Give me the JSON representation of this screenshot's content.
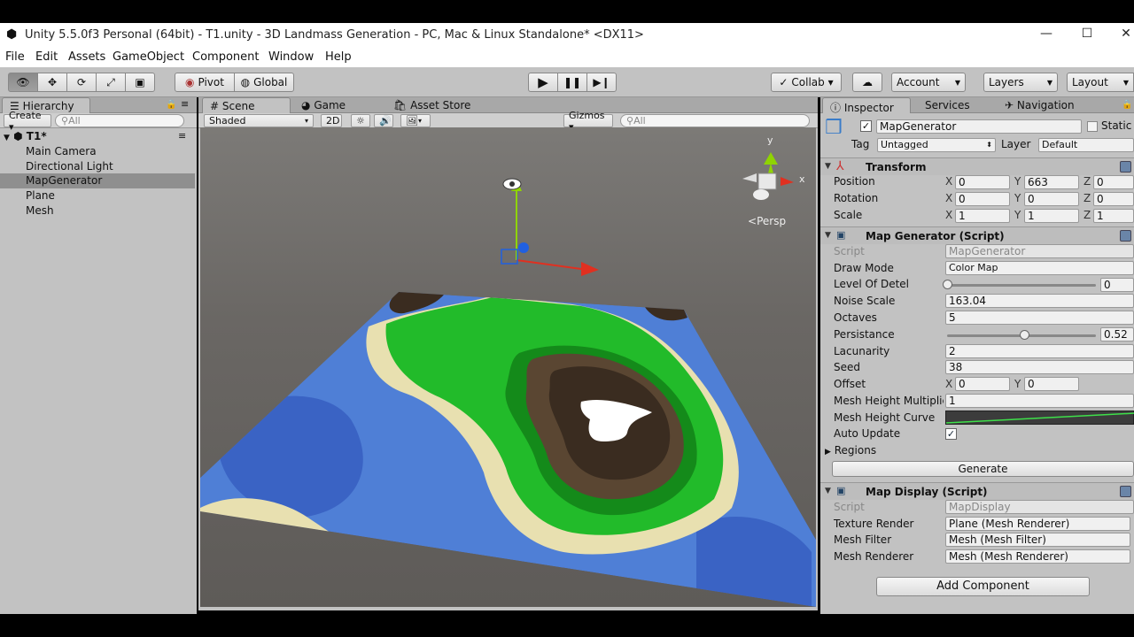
{
  "window": {
    "title": "Unity 5.5.0f3 Personal (64bit) - T1.unity - 3D Landmass Generation - PC, Mac & Linux Standalone* <DX11>",
    "minimize": "—",
    "maximize": "☐",
    "close": "✕"
  },
  "menu": [
    "File",
    "Edit",
    "Assets",
    "GameObject",
    "Component",
    "Window",
    "Help"
  ],
  "toolbar": {
    "pivot": "Pivot",
    "global": "Global",
    "collab": "Collab ▾",
    "account": "Account",
    "layers": "Layers",
    "layout": "Layout"
  },
  "hierarchy": {
    "tab": "Hierarchy",
    "create": "Create ▾",
    "search_placeholder": "All",
    "scene": "T1*",
    "items": [
      "Main Camera",
      "Directional Light",
      "MapGenerator",
      "Plane",
      "Mesh"
    ],
    "selected_index": 2
  },
  "scene": {
    "tabs": [
      "Scene",
      "Game",
      "Asset Store"
    ],
    "shading": "Shaded",
    "mode2d": "2D",
    "gizmos": "Gizmos ▾",
    "search_placeholder": "All",
    "persp": "Persp",
    "axis_y": "y",
    "axis_x": "x"
  },
  "inspector": {
    "tabs": [
      "Inspector",
      "Services",
      "Navigation"
    ],
    "object_name": "MapGenerator",
    "static": "Static",
    "tag_label": "Tag",
    "tag_value": "Untagged",
    "layer_label": "Layer",
    "layer_value": "Default",
    "transform": {
      "title": "Transform",
      "position_label": "Position",
      "rotation_label": "Rotation",
      "scale_label": "Scale",
      "position": [
        "0",
        "663",
        "0"
      ],
      "rotation": [
        "0",
        "0",
        "0"
      ],
      "scale": [
        "1",
        "1",
        "1"
      ]
    },
    "map_generator": {
      "title": "Map Generator (Script)",
      "script_label": "Script",
      "script_value": "MapGenerator",
      "draw_mode_label": "Draw Mode",
      "draw_mode_value": "Color Map",
      "lod_label": "Level Of Detel",
      "lod_value": "0",
      "lod_fraction": 0.0,
      "noise_scale_label": "Noise Scale",
      "noise_scale_value": "163.04",
      "octaves_label": "Octaves",
      "octaves_value": "5",
      "persistance_label": "Persistance",
      "persistance_value": "0.52",
      "persistance_fraction": 0.52,
      "lacunarity_label": "Lacunarity",
      "lacunarity_value": "2",
      "seed_label": "Seed",
      "seed_value": "38",
      "offset_label": "Offset",
      "offset_x": "0",
      "offset_y": "0",
      "mesh_height_mult_label": "Mesh Height Multiplie",
      "mesh_height_mult_value": "1",
      "mesh_height_curve_label": "Mesh Height Curve",
      "auto_update_label": "Auto Update",
      "regions_label": "Regions",
      "generate_button": "Generate"
    },
    "map_display": {
      "title": "Map Display (Script)",
      "script_label": "Script",
      "script_value": "MapDisplay",
      "texture_render_label": "Texture Render",
      "texture_render_value": "Plane (Mesh Renderer)",
      "mesh_filter_label": "Mesh Filter",
      "mesh_filter_value": "Mesh (Mesh Filter)",
      "mesh_renderer_label": "Mesh Renderer",
      "mesh_renderer_value": "Mesh (Mesh Renderer)"
    },
    "add_component": "Add Component"
  },
  "colors": {
    "water": "#4f7fd6",
    "deep_water": "#3a63c4",
    "sand": "#e8e0b0",
    "grass": "#22bb2a",
    "dark_grass": "#148a1a",
    "rock": "#5a4632",
    "dark_rock": "#3a2c20",
    "snow": "#ffffff"
  }
}
